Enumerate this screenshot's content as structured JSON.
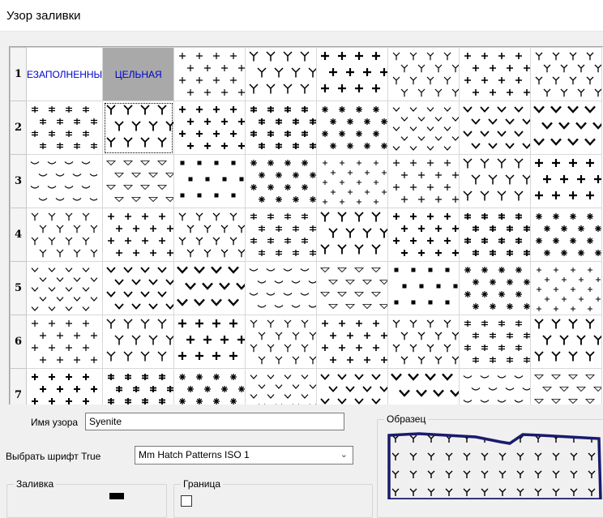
{
  "window": {
    "title": "Узор заливки"
  },
  "grid": {
    "row_labels": [
      "1",
      "2",
      "3",
      "4",
      "5",
      "6",
      "7"
    ],
    "special_cells": {
      "unfilled": "ЕЗАПОЛНЕННЫ",
      "solid": "ЦЕЛЬНАЯ"
    },
    "selected_cell": "row 2, column 2"
  },
  "form": {
    "pattern_name_label": "Имя узора",
    "pattern_name_value": "Syenite",
    "font_label": "Выбрать шрифт True",
    "font_value": "Mm Hatch Patterns ISO 1",
    "fill_group_label": "Заливка",
    "border_group_label": "Граница",
    "preview_group_label": "Образец"
  },
  "colors": {
    "preview_outline": "#1a1a6e",
    "text_link": "#0000d0",
    "solid_fill": "#a9a9a9"
  }
}
